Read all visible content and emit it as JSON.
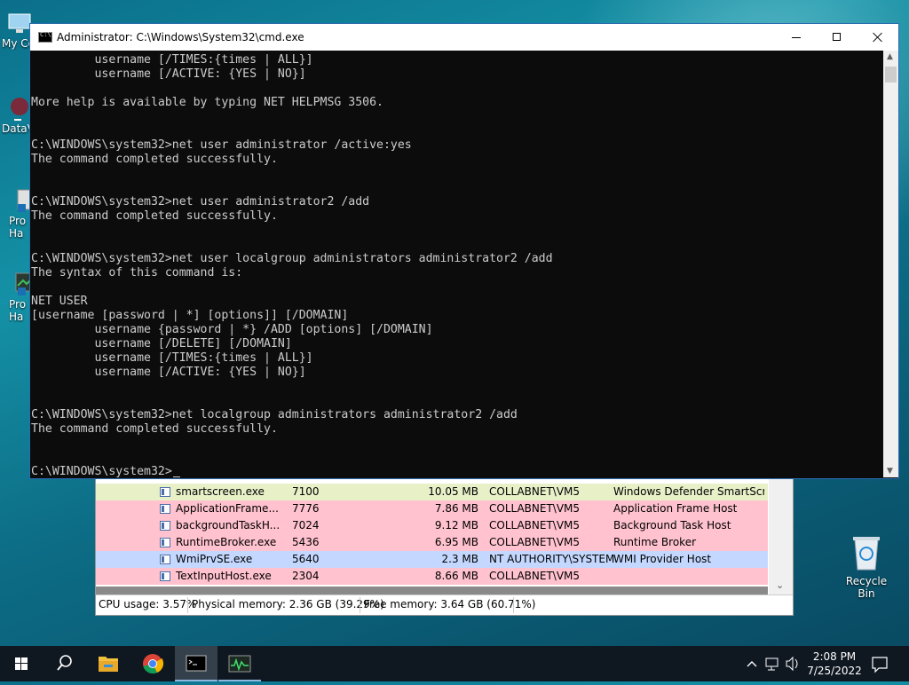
{
  "desktop": {
    "icons": [
      {
        "label": "My Co"
      },
      {
        "label": "DataV"
      },
      {
        "label": "Pro"
      },
      {
        "label": "Ha"
      },
      {
        "label": "Pro"
      },
      {
        "label": "Ha"
      }
    ],
    "recycle_bin": "Recycle Bin"
  },
  "cmd": {
    "title": "Administrator: C:\\Windows\\System32\\cmd.exe",
    "lines": [
      "         username [/TIMES:{times | ALL}]",
      "         username [/ACTIVE: {YES | NO}]",
      "",
      "More help is available by typing NET HELPMSG 3506.",
      "",
      "",
      "C:\\WINDOWS\\system32>net user administrator /active:yes",
      "The command completed successfully.",
      "",
      "",
      "C:\\WINDOWS\\system32>net user administrator2 /add",
      "The command completed successfully.",
      "",
      "",
      "C:\\WINDOWS\\system32>net user localgroup administrators administrator2 /add",
      "The syntax of this command is:",
      "",
      "NET USER",
      "[username [password | *] [options]] [/DOMAIN]",
      "         username {password | *} /ADD [options] [/DOMAIN]",
      "         username [/DELETE] [/DOMAIN]",
      "         username [/TIMES:{times | ALL}]",
      "         username [/ACTIVE: {YES | NO}]",
      "",
      "",
      "C:\\WINDOWS\\system32>net localgroup administrators administrator2 /add",
      "The command completed successfully.",
      "",
      "",
      "C:\\WINDOWS\\system32>"
    ]
  },
  "process_explorer": {
    "rows": [
      {
        "name": "smartscreen.exe",
        "pid": "7100",
        "mem": "10.05 MB",
        "user": "COLLABNET\\VM5",
        "desc": "Windows Defender SmartScre...",
        "color": "#e8f0c8"
      },
      {
        "name": "ApplicationFrame...",
        "pid": "7776",
        "mem": "7.86 MB",
        "user": "COLLABNET\\VM5",
        "desc": "Application Frame Host",
        "color": "#ffc2ce"
      },
      {
        "name": "backgroundTaskH...",
        "pid": "7024",
        "mem": "9.12 MB",
        "user": "COLLABNET\\VM5",
        "desc": "Background Task Host",
        "color": "#ffc2ce"
      },
      {
        "name": "RuntimeBroker.exe",
        "pid": "5436",
        "mem": "6.95 MB",
        "user": "COLLABNET\\VM5",
        "desc": "Runtime Broker",
        "color": "#ffc2ce"
      },
      {
        "name": "WmiPrvSE.exe",
        "pid": "5640",
        "mem": "2.3 MB",
        "user": "NT AUTHORITY\\SYSTEM",
        "desc": "WMI Provider Host",
        "color": "#c4d8ff"
      },
      {
        "name": "TextInputHost.exe",
        "pid": "2304",
        "mem": "8.66 MB",
        "user": "COLLABNET\\VM5",
        "desc": "",
        "color": "#ffc2ce"
      }
    ],
    "status": {
      "cpu": "CPU usage: 3.57%",
      "physical": "Physical memory: 2.36 GB (39.29%)",
      "free": "Free memory: 3.64 GB (60.71%)"
    }
  },
  "taskbar": {
    "apps": [
      "start",
      "search",
      "file-explorer",
      "chrome",
      "cmd",
      "process-explorer"
    ],
    "time": "2:08 PM",
    "date": "7/25/2022"
  }
}
